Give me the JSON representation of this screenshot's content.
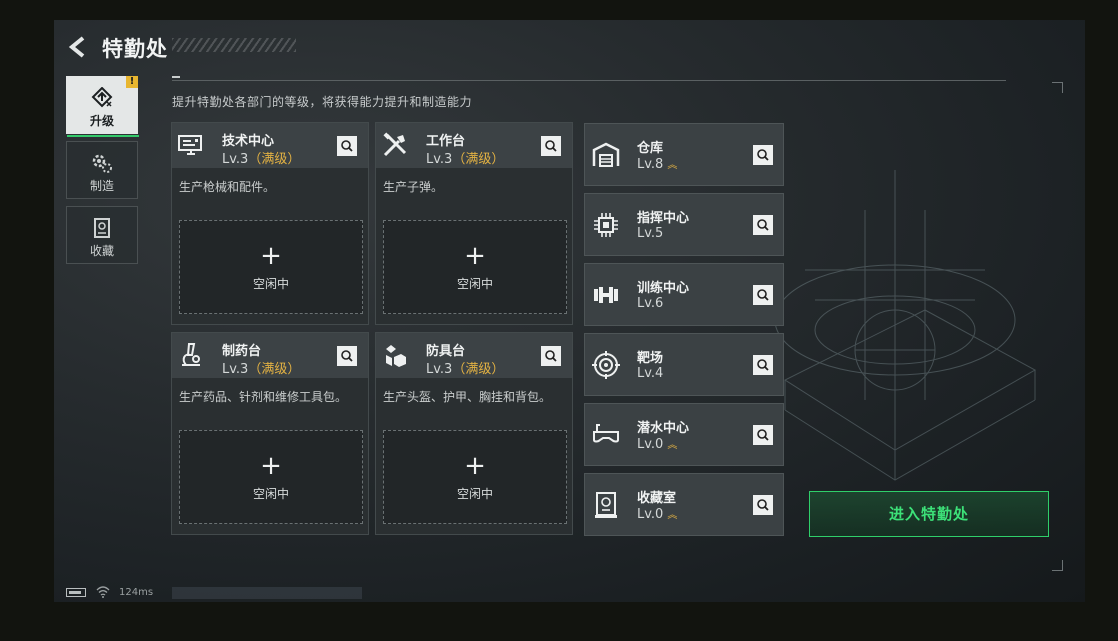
{
  "header": {
    "title": "特勤处",
    "back_icon": "back-arrow-icon"
  },
  "subtitle": "提升特勤处各部门的等级，将获得能力提升和制造能力",
  "sidebar": {
    "items": [
      {
        "label": "升级",
        "icon": "upgrade-icon",
        "active": true,
        "badge": "!"
      },
      {
        "label": "制造",
        "icon": "gears-icon",
        "active": false
      },
      {
        "label": "收藏",
        "icon": "collection-icon",
        "active": false
      }
    ]
  },
  "workstations": [
    {
      "name": "技术中心",
      "level": "Lv.3",
      "status": "（满级）",
      "desc": "生产枪械和配件。",
      "slot_label": "空闲中",
      "icon": "computer-icon"
    },
    {
      "name": "工作台",
      "level": "Lv.3",
      "status": "（满级）",
      "desc": "生产子弹。",
      "slot_label": "空闲中",
      "icon": "tools-icon"
    },
    {
      "name": "制药台",
      "level": "Lv.3",
      "status": "（满级）",
      "desc": "生产药品、针剂和维修工具包。",
      "slot_label": "空闲中",
      "icon": "microscope-icon"
    },
    {
      "name": "防具台",
      "level": "Lv.3",
      "status": "（满级）",
      "desc": "生产头盔、护甲、胸挂和背包。",
      "slot_label": "空闲中",
      "icon": "armor-icon"
    }
  ],
  "facilities": [
    {
      "name": "仓库",
      "level": "Lv.8",
      "upgradable": true,
      "icon": "warehouse-icon"
    },
    {
      "name": "指挥中心",
      "level": "Lv.5",
      "upgradable": false,
      "icon": "chip-icon"
    },
    {
      "name": "训练中心",
      "level": "Lv.6",
      "upgradable": false,
      "icon": "dumbbell-icon"
    },
    {
      "name": "靶场",
      "level": "Lv.4",
      "upgradable": false,
      "icon": "target-icon"
    },
    {
      "name": "潜水中心",
      "level": "Lv.0",
      "upgradable": true,
      "icon": "diving-mask-icon"
    },
    {
      "name": "收藏室",
      "level": "Lv.0",
      "upgradable": true,
      "icon": "display-case-icon"
    }
  ],
  "enter_button": "进入特勤处",
  "status": {
    "ping": "124ms"
  },
  "colors": {
    "accent_green": "#33c96a",
    "max_level_gold": "#e3b243",
    "badge_yellow": "#e8b630"
  }
}
